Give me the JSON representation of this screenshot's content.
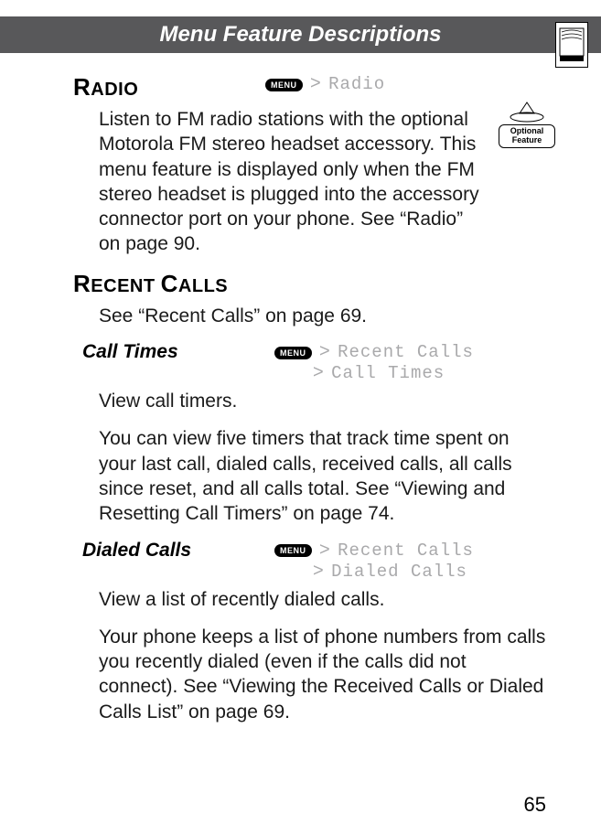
{
  "header": {
    "title": "Menu Feature Descriptions"
  },
  "optional_badge": {
    "line1": "Optional",
    "line2": "Feature"
  },
  "radio": {
    "heading_big": "R",
    "heading_rest": "ADIO",
    "menu_label": "MENU",
    "crumb": "Radio",
    "body": "Listen to FM radio stations with the optional Motorola FM stereo headset accessory. This menu feature is displayed only when the FM stereo headset is plugged into the accessory connector port on your phone. See “Radio” on page 90."
  },
  "recent_calls": {
    "heading_big": "R",
    "heading_rest": "ECENT ",
    "heading_big2": "C",
    "heading_rest2": "ALLS",
    "body": "See “Recent Calls” on page 69."
  },
  "call_times": {
    "title": "Call Times",
    "menu_label": "MENU",
    "crumb1": "Recent Calls",
    "crumb2": "Call Times",
    "body1": "View call timers.",
    "body2": "You can view five timers that track time spent on your last call, dialed calls, received calls, all calls since reset, and all calls total. See “Viewing and Resetting Call Timers” on page 74."
  },
  "dialed_calls": {
    "title": "Dialed Calls",
    "menu_label": "MENU",
    "crumb1": "Recent Calls",
    "crumb2": "Dialed Calls",
    "body1": "View a list of recently dialed calls.",
    "body2": "Your phone keeps a list of phone numbers from calls you recently dialed (even if the calls did not connect). See “Viewing the Received Calls or Dialed Calls List” on page 69."
  },
  "page_number": "65"
}
